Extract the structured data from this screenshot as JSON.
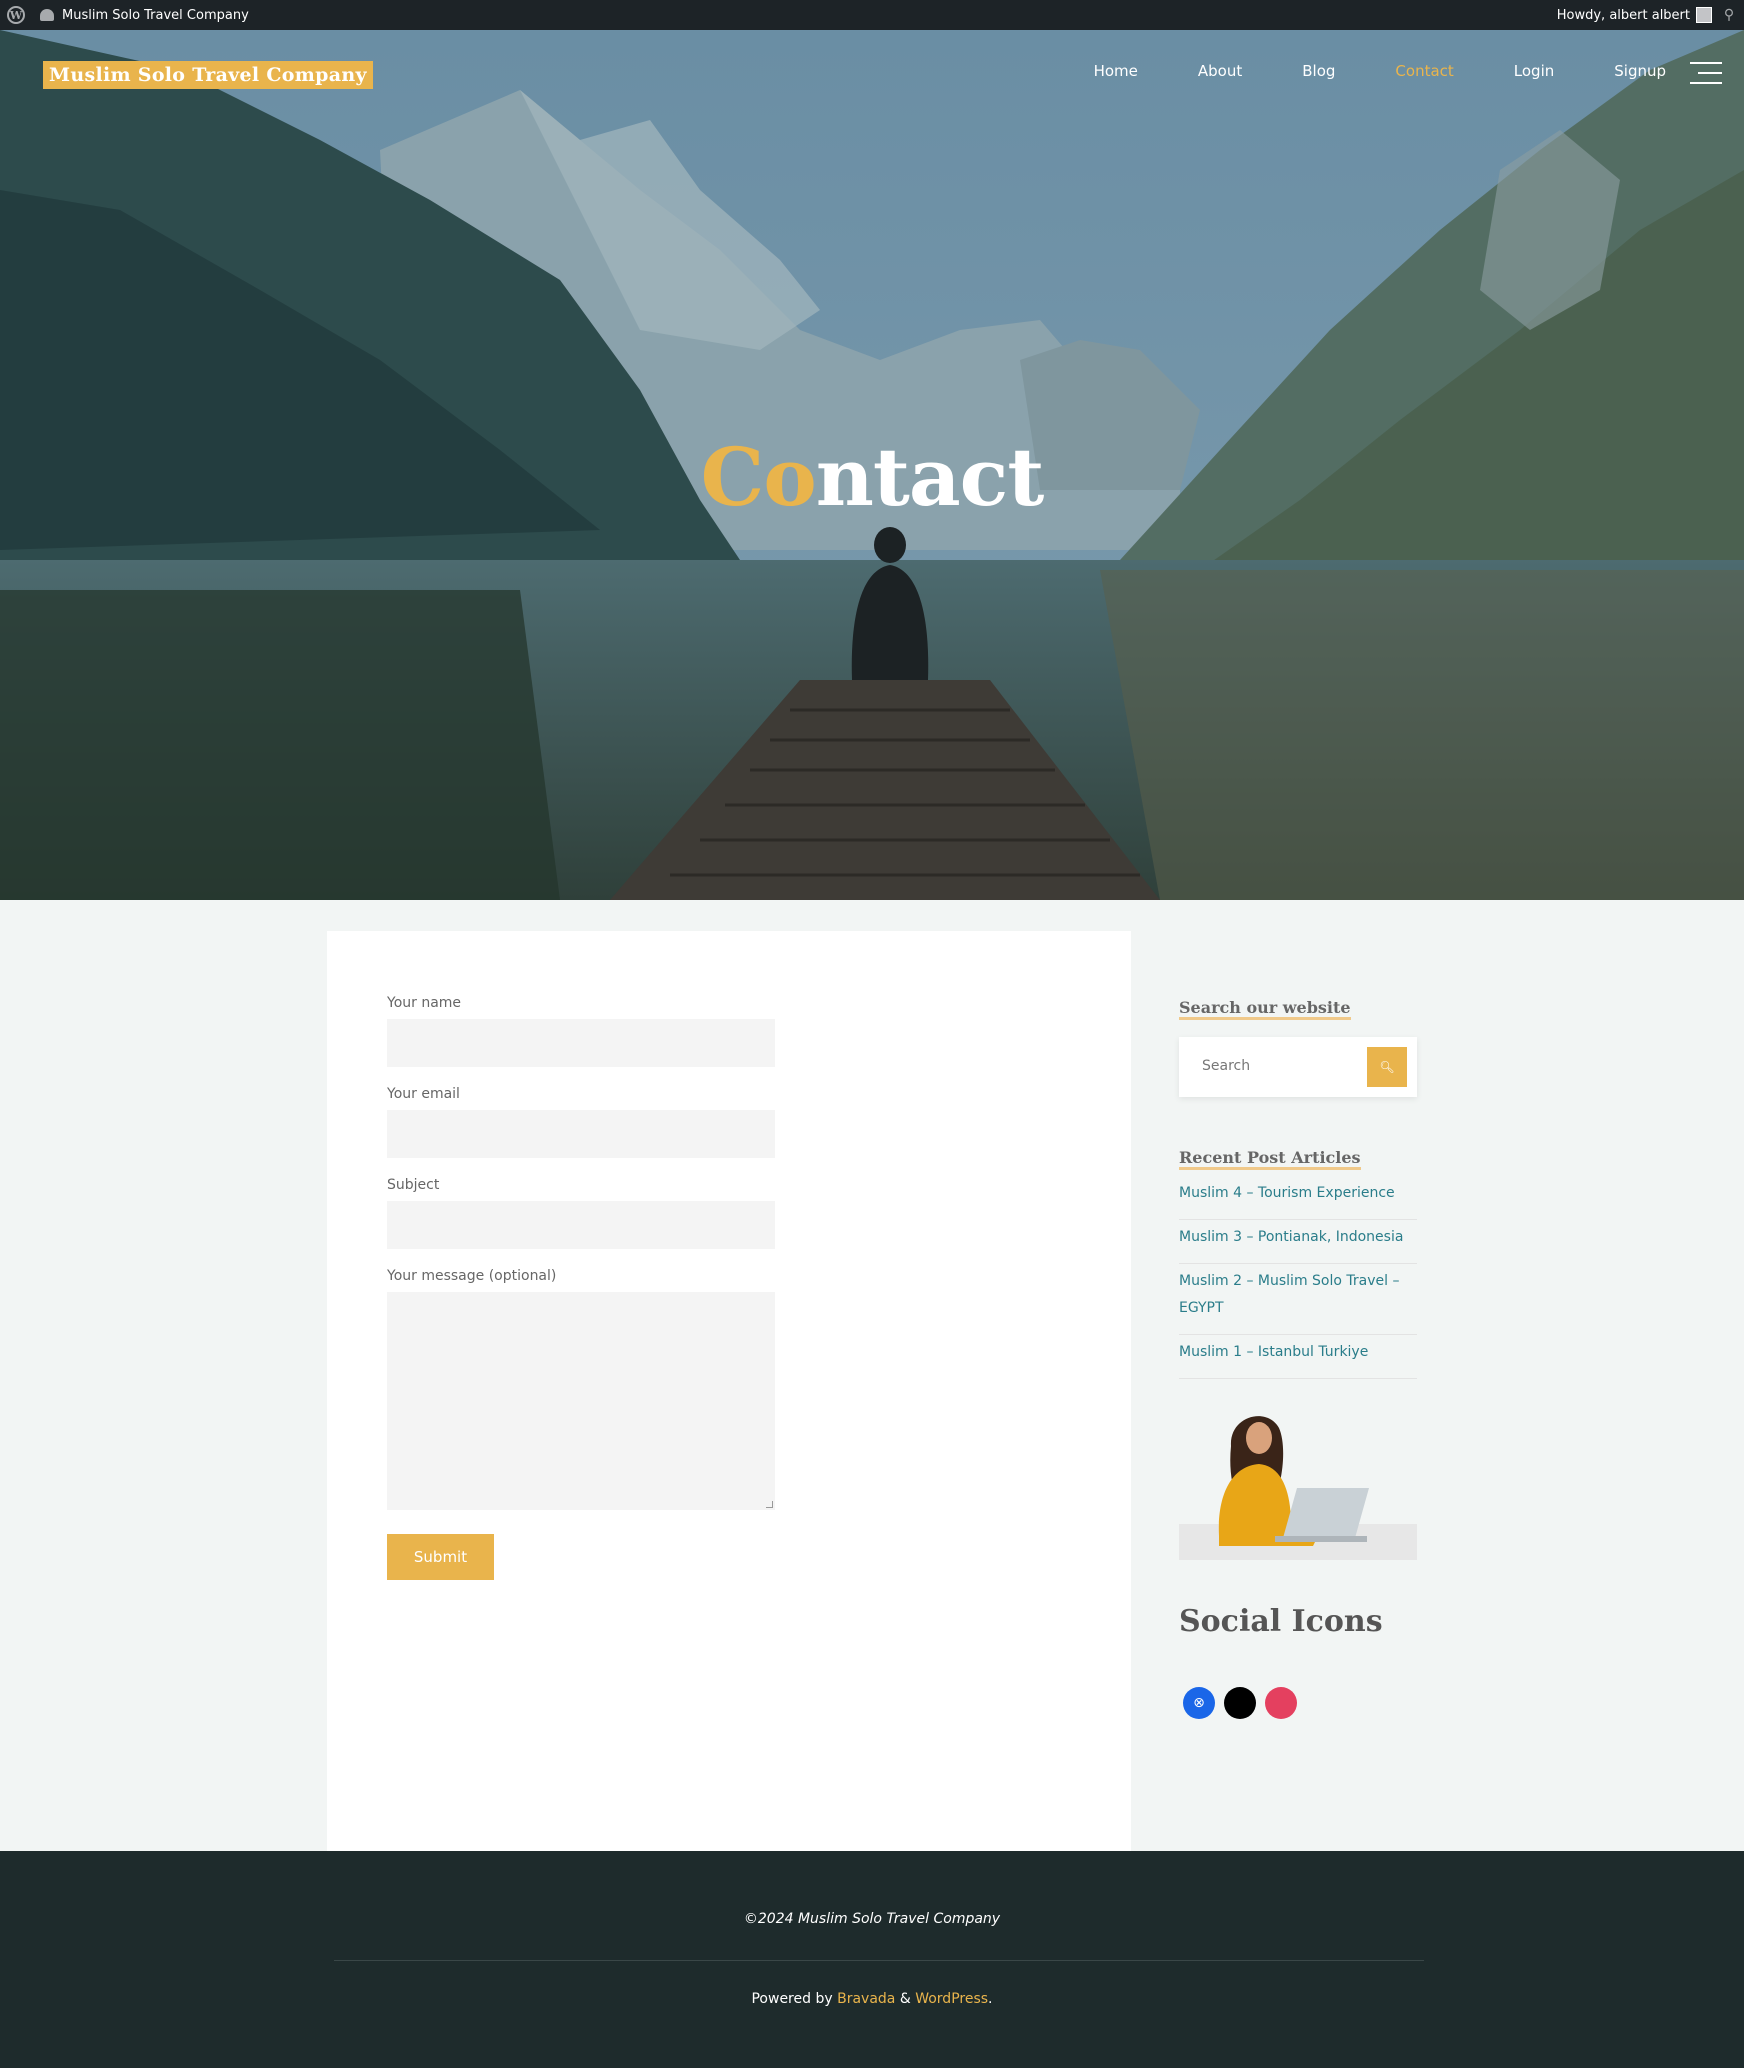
{
  "admin_bar": {
    "site_name": "Muslim Solo Travel Company",
    "greeting": "Howdy, albert albert"
  },
  "header": {
    "brand": "Muslim Solo Travel Company",
    "nav": [
      {
        "label": "Home",
        "active": false
      },
      {
        "label": "About",
        "active": false
      },
      {
        "label": "Blog",
        "active": false
      },
      {
        "label": "Contact",
        "active": true
      },
      {
        "label": "Login",
        "active": false
      },
      {
        "label": "Signup",
        "active": false
      }
    ]
  },
  "hero": {
    "title_accent": "Co",
    "title_rest": "ntact"
  },
  "form": {
    "name_label": "Your name",
    "email_label": "Your email",
    "subject_label": "Subject",
    "message_label": "Your message (optional)",
    "submit_label": "Submit"
  },
  "sidebar": {
    "search_title": "Search our website",
    "search_placeholder": "Search",
    "recent_title": "Recent Post Articles",
    "recent_posts": [
      "Muslim 4 – Tourism Experience",
      "Muslim 3 – Pontianak, Indonesia",
      "Muslim 2 – Muslim Solo Travel – EGYPT",
      "Muslim 1 – Istanbul Turkiye"
    ],
    "social_title": "Social Icons",
    "social_icons": [
      {
        "name": "xbox-icon",
        "color": "#1a66e8"
      },
      {
        "name": "x-icon",
        "color": "#000000"
      },
      {
        "name": "dribbble-icon",
        "color": "#e4405f"
      }
    ]
  },
  "footer": {
    "copyright": "©2024 Muslim Solo Travel Company",
    "powered_prefix": "Powered by",
    "powered_theme": "Bravada",
    "powered_amp": "&",
    "powered_wp": "WordPress",
    "powered_suffix": "."
  },
  "colors": {
    "accent": "#e9b44c",
    "link": "#2a7d8a",
    "footer_bg": "#1e2b2c",
    "admin_bg": "#1d2327"
  }
}
